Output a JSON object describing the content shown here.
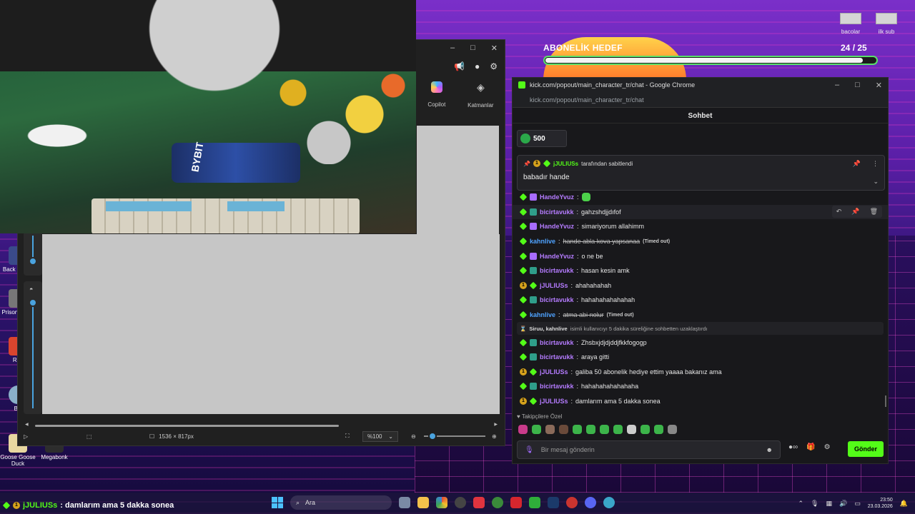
{
  "overlay": {
    "goal_title": "ABONELİK HEDEF",
    "goal_current": "24",
    "goal_total": "/ 25",
    "goal_progress": 0.96,
    "top_right_labels": [
      "bacolar",
      "ilk sub"
    ]
  },
  "desktop_icons": [
    {
      "label": "Back Escap"
    },
    {
      "label": "Prison Simul"
    },
    {
      "label": "Rec"
    },
    {
      "label": "BA"
    },
    {
      "label": "Goose Goose Duck"
    },
    {
      "label": "Megabonk"
    }
  ],
  "webcam": {
    "car_text": "BYBIT"
  },
  "viewer": {
    "window_controls": [
      "–",
      "□",
      "✕"
    ],
    "copilot_label": "Copilot",
    "layers_label": "Katmanlar",
    "dimensions": "1536 × 817px",
    "zoom": "%100"
  },
  "chrome": {
    "window_title": "kick.com/popout/main_character_tr/chat - Google Chrome",
    "url": "kick.com/popout/main_character_tr/chat",
    "window_controls": [
      "–",
      "□",
      "✕"
    ]
  },
  "chat": {
    "header": "Sohbet",
    "gift_amount": "500",
    "pinned": {
      "username": "jJULIUSs",
      "by_text": "tarafından sabitlendi",
      "message": "babadır hande"
    },
    "messages": [
      {
        "user": "HandeYvuz",
        "color": "purple",
        "badges": [
          "green",
          "purple"
        ],
        "text": "",
        "emote": true
      },
      {
        "user": "bicirtavukk",
        "color": "purple",
        "badges": [
          "green",
          "sub"
        ],
        "text": "gahzshdjjdıfof",
        "highlight": true
      },
      {
        "user": "HandeYvuz",
        "color": "purple",
        "badges": [
          "green",
          "purple"
        ],
        "text": "simariyorum allahimm"
      },
      {
        "user": "kahnlive",
        "color": "blue",
        "badges": [
          "green"
        ],
        "text": "hande abla kova yapsanaa",
        "struck": true,
        "timed_out": "(Timed out)"
      },
      {
        "user": "HandeYvuz",
        "color": "purple",
        "badges": [
          "green",
          "purple"
        ],
        "text": "o ne be"
      },
      {
        "user": "bicirtavukk",
        "color": "purple",
        "badges": [
          "green",
          "sub"
        ],
        "text": "hasan kesin amk"
      },
      {
        "user": "jJULIUSs",
        "color": "purple",
        "badges": [
          "gold",
          "green"
        ],
        "text": "ahahahahah"
      },
      {
        "user": "bicirtavukk",
        "color": "purple",
        "badges": [
          "green",
          "sub"
        ],
        "text": "hahahahahahahah"
      },
      {
        "user": "kahnlive",
        "color": "blue",
        "badges": [
          "green"
        ],
        "text": "atma abi nolur",
        "struck": true,
        "timed_out": "(Timed out)"
      }
    ],
    "system_message": {
      "actor": "Siruu, kahnlive",
      "text": "isimli kullanıcıyı 5 dakika süreliğine sohbetten uzaklaştırdı"
    },
    "messages_after": [
      {
        "user": "bicirtavukk",
        "color": "purple",
        "badges": [
          "green",
          "sub"
        ],
        "text": "Zhsbxjdjdjddjfkkfogogp"
      },
      {
        "user": "bicirtavukk",
        "color": "purple",
        "badges": [
          "green",
          "sub"
        ],
        "text": "araya gitti"
      },
      {
        "user": "jJULIUSs",
        "color": "purple",
        "badges": [
          "gold",
          "green"
        ],
        "text": "galiba 50 abonelik hediye ettim yaaaa bakanız ama"
      },
      {
        "user": "bicirtavukk",
        "color": "purple",
        "badges": [
          "green",
          "sub"
        ],
        "text": "hahahahahahahaha"
      },
      {
        "user": "jJULIUSs",
        "color": "purple",
        "badges": [
          "gold",
          "green"
        ],
        "text": "damlarım ama 5 dakka sonea"
      }
    ],
    "followers_label": "Takipçilere Özel",
    "input_placeholder": "Bir mesaj gönderin",
    "send_label": "Gönder"
  },
  "ticker": {
    "user": "jJULIUSs",
    "text": ": damlarım ama 5 dakka sonea"
  },
  "taskbar": {
    "search_placeholder": "Ara",
    "time": "23:50",
    "date": "23.03.2026"
  },
  "colors": {
    "kick_green": "#53fc18",
    "chat_bg": "#18181b",
    "purple_user": "#b57cff",
    "blue_user": "#4fa3ff"
  }
}
